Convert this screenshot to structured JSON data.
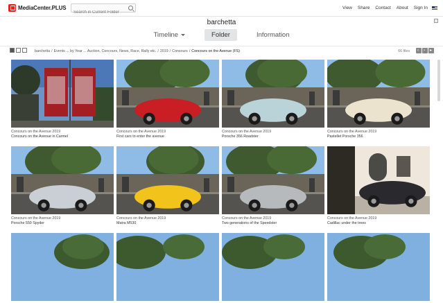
{
  "header": {
    "logo": "MediaCenter.PLUS",
    "search_placeholder": "Search in Current Folder",
    "nav": [
      "View",
      "Share",
      "Contact",
      "About",
      "Sign In"
    ]
  },
  "page": {
    "title": "barchetta",
    "tabs": [
      {
        "label": "Timeline",
        "active": false
      },
      {
        "label": "Folder",
        "active": true
      },
      {
        "label": "Information",
        "active": false
      }
    ]
  },
  "breadcrumb": {
    "items": [
      "barchetta",
      "Events ... by Year ... Auction, Concours, News, Race, Rally etc.",
      "2019",
      "Concours"
    ],
    "current": "Concours on the Avenue (FS)",
    "file_count": "66 files"
  },
  "photos": [
    {
      "folder": "Concours on the Avenue 2019",
      "caption": "Concours on the Avenue in Carmel",
      "scene": "banner",
      "car_color": "#b21f24"
    },
    {
      "folder": "Concours on the Avenue 2019",
      "caption": "First cars to enter the avenue",
      "scene": "street",
      "car_color": "#c81e24"
    },
    {
      "folder": "Concours on the Avenue 2019",
      "caption": "Porsche 356 Roadster",
      "scene": "street",
      "car_color": "#b9d3d8"
    },
    {
      "folder": "Concours on the Avenue 2019",
      "caption": "Pastellet Porsche 356",
      "scene": "street",
      "car_color": "#ece3cf"
    },
    {
      "folder": "Concours on the Avenue 2019",
      "caption": "Porsche 550 Spyder",
      "scene": "street",
      "car_color": "#c9cfd4"
    },
    {
      "folder": "Concours on the Avenue 2019",
      "caption": "Matra M530",
      "scene": "street",
      "car_color": "#f2c31b"
    },
    {
      "folder": "Concours on the Avenue 2019",
      "caption": "Two generations of the Speedster",
      "scene": "street",
      "car_color": "#b7babd"
    },
    {
      "folder": "Concours on the Avenue 2019",
      "caption": "Cadillac under the trees",
      "scene": "building",
      "car_color": "#2a2a2e"
    },
    {
      "folder": "",
      "caption": "",
      "scene": "sky",
      "car_color": ""
    },
    {
      "folder": "",
      "caption": "",
      "scene": "sky",
      "car_color": ""
    },
    {
      "folder": "",
      "caption": "",
      "scene": "sky",
      "car_color": ""
    },
    {
      "folder": "",
      "caption": "",
      "scene": "sky",
      "car_color": ""
    }
  ]
}
